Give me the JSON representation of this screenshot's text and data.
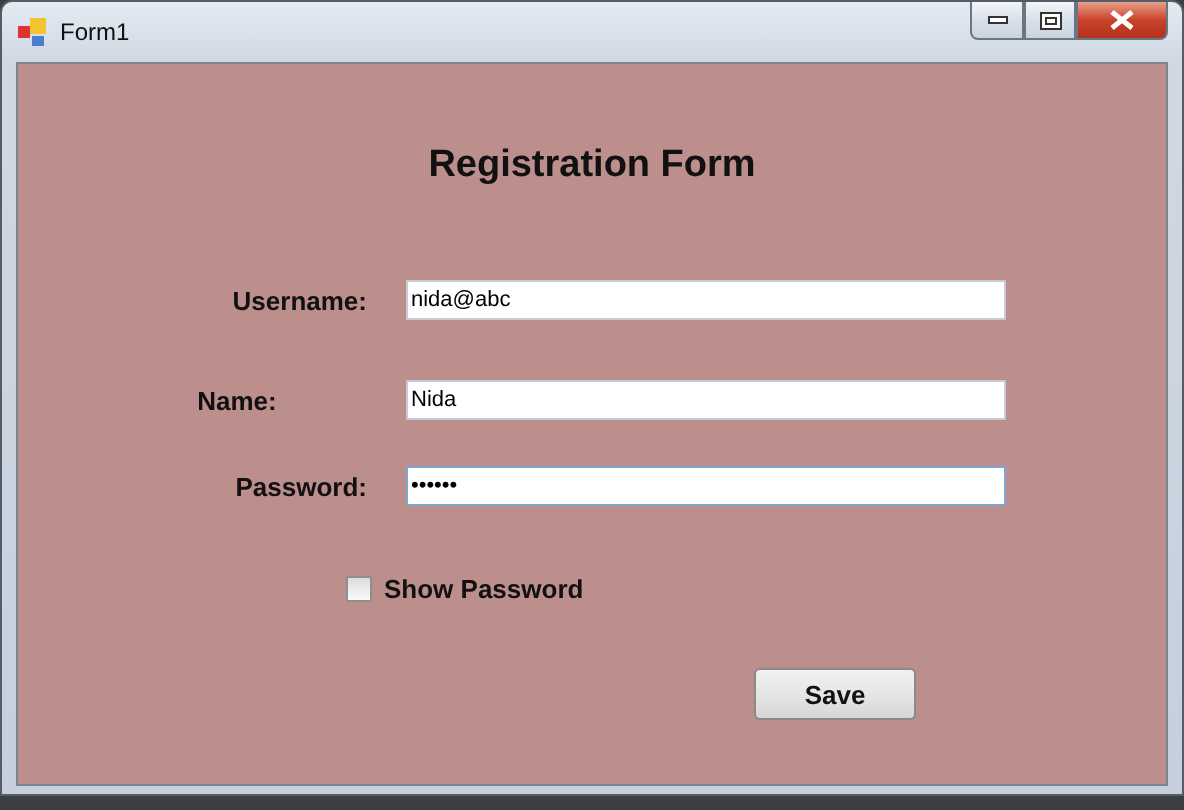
{
  "window": {
    "title": "Form1"
  },
  "form": {
    "heading": "Registration Form",
    "fields": [
      {
        "label": "Username:",
        "value": "nida@abc",
        "focused": false
      },
      {
        "label": "Name:",
        "value": "Nida",
        "focused": false
      },
      {
        "label": "Password:",
        "value": "••••••",
        "focused": true
      }
    ],
    "show_password": {
      "label": "Show Password",
      "checked": false
    },
    "buttons": [
      "Save"
    ]
  }
}
